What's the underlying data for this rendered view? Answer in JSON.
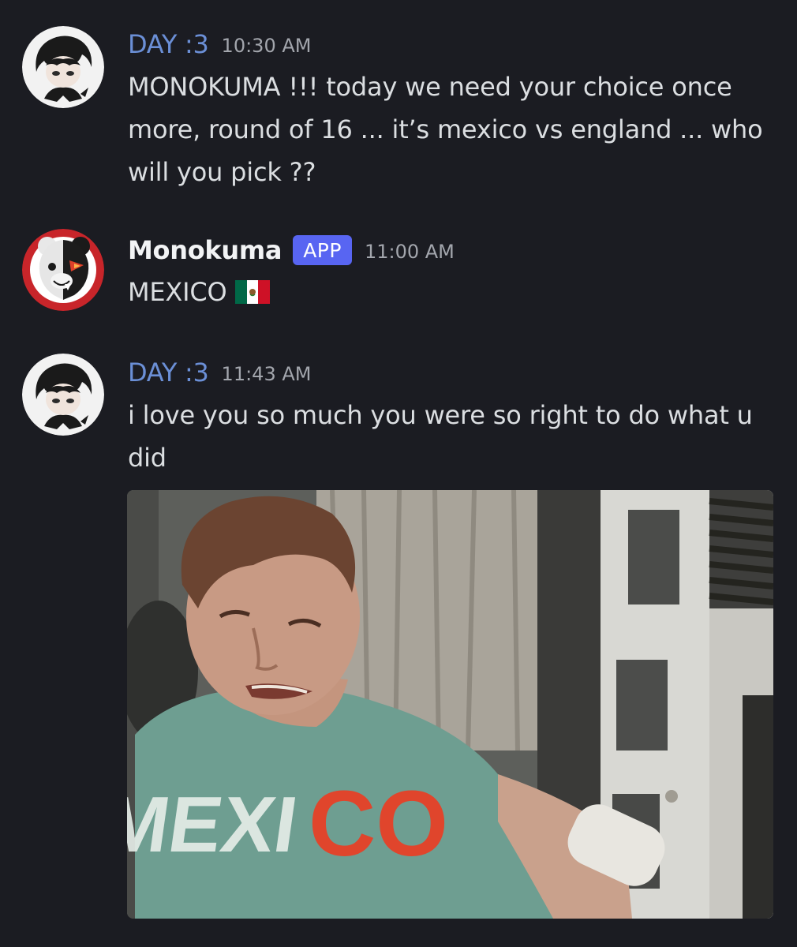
{
  "messages": [
    {
      "username": "DAY :3",
      "timestamp": "10:30 AM",
      "content": "MONOKUMA !!! today we need your choice once more, round of 16 ... it’s mexico vs england ... who will you pick ??"
    },
    {
      "username": "Monokuma",
      "badge": "APP",
      "timestamp": "11:00 AM",
      "content": "MEXICO",
      "emoji": "mexico-flag"
    },
    {
      "username": "DAY :3",
      "timestamp": "11:43 AM",
      "content": "i love you so much you were so right to do what u did",
      "attachment": {
        "type": "gif",
        "shirt_text": [
          "MEXI",
          "CO"
        ]
      }
    }
  ],
  "colors": {
    "background": "#1b1c22",
    "username_day": "#6b8fd6",
    "username_bot": "#f2f3f5",
    "badge_bg": "#5865f2",
    "timestamp": "#a3a6ad",
    "text": "#dbdee1"
  }
}
